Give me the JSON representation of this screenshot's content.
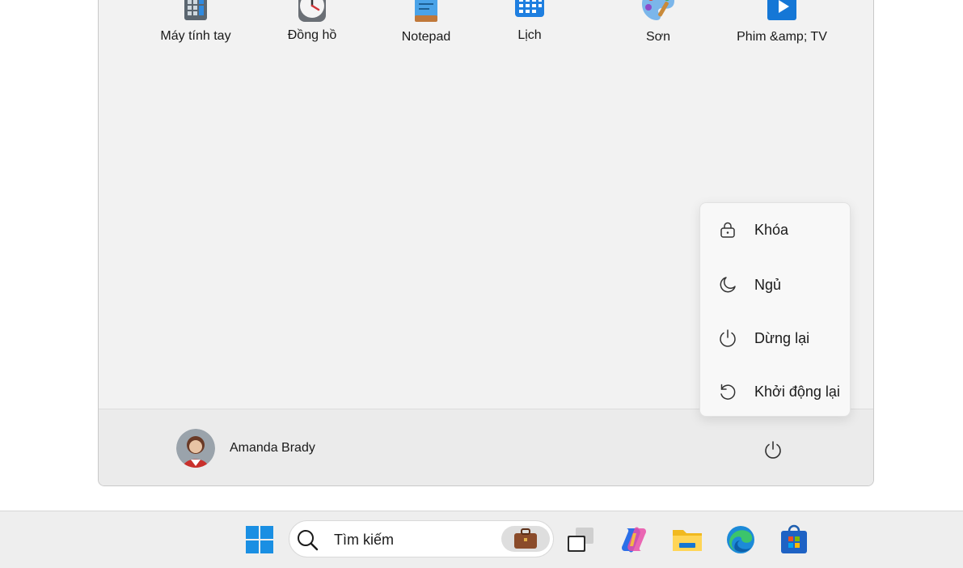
{
  "start_menu": {
    "pinned_apps": [
      {
        "label": "Máy tính tay",
        "icon": "calculator-icon"
      },
      {
        "label": "Đồng hồ",
        "icon": "clock-icon"
      },
      {
        "label": "Notepad",
        "icon": "notepad-icon"
      },
      {
        "label": "Lịch",
        "icon": "calendar-icon"
      },
      {
        "label": "Sơn",
        "icon": "paint-icon"
      },
      {
        "label": "Phim &amp; TV",
        "icon": "movies-tv-icon"
      }
    ],
    "user": {
      "name": "Amanda Brady",
      "avatar": "user-avatar"
    },
    "power_button": {
      "icon": "power-icon"
    }
  },
  "power_flyout": {
    "items": [
      {
        "label": "Khóa",
        "icon": "lock-icon"
      },
      {
        "label": "Ngủ",
        "icon": "sleep-moon-icon"
      },
      {
        "label": "Dừng lại",
        "icon": "shutdown-icon"
      },
      {
        "label": "Khởi động lại",
        "icon": "restart-icon"
      }
    ]
  },
  "taskbar": {
    "start_icon": "windows-start-icon",
    "search": {
      "placeholder": "Tìm kiếm",
      "icon": "search-icon",
      "badge_icon": "briefcase-icon"
    },
    "apps": [
      {
        "icon": "task-view-icon"
      },
      {
        "icon": "copilot-icon"
      },
      {
        "icon": "file-explorer-icon"
      },
      {
        "icon": "edge-browser-icon"
      },
      {
        "icon": "microsoft-store-icon"
      }
    ]
  },
  "colors": {
    "accent": "#0078d4",
    "menu_bg": "#f2f2f2",
    "taskbar_bg": "#eeeeee"
  }
}
